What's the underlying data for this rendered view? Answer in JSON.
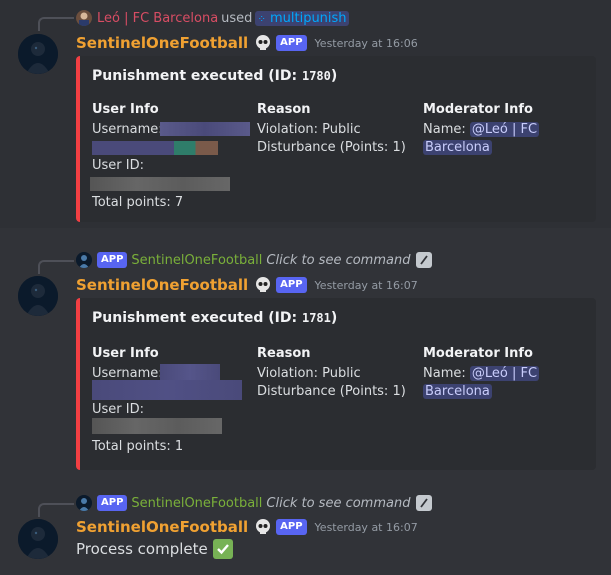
{
  "colors": {
    "accent": "#5865f2",
    "embed_bar": "#f23f43",
    "bot_name": "#f0a132"
  },
  "message1": {
    "reply_user": "Leó | FC Barcelona",
    "reply_used": "used",
    "reply_command": "multipunish",
    "author": "SentinelOneFootball",
    "badge": "APP",
    "timestamp": "Yesterday at 16:06",
    "embed": {
      "title_prefix": "Punishment executed (ID: ",
      "id": "1780",
      "title_suffix": ")",
      "user_info_label": "User Info",
      "username_label": "Username:",
      "userid_label": "User ID:",
      "total_points": "Total points: 7",
      "reason_label": "Reason",
      "reason_line1": "Violation: Public",
      "reason_line2": "Disturbance (Points: 1)",
      "moderator_label": "Moderator Info",
      "name_label": "Name:",
      "mod_line1": "@Leó | FC",
      "mod_line2": "Barcelona"
    }
  },
  "message2": {
    "reply_badge": "APP",
    "reply_user": "SentinelOneFootball",
    "reply_hint": "Click to see command",
    "author": "SentinelOneFootball",
    "badge": "APP",
    "timestamp": "Yesterday at 16:07",
    "embed": {
      "title_prefix": "Punishment executed (ID: ",
      "id": "1781",
      "title_suffix": ")",
      "user_info_label": "User Info",
      "username_label": "Username:",
      "userid_label": "User ID:",
      "total_points": "Total points: 1",
      "reason_label": "Reason",
      "reason_line1": "Violation: Public",
      "reason_line2": "Disturbance (Points: 1)",
      "moderator_label": "Moderator Info",
      "name_label": "Name:",
      "mod_line1": "@Leó | FC",
      "mod_line2": "Barcelona"
    }
  },
  "message3": {
    "reply_badge": "APP",
    "reply_user": "SentinelOneFootball",
    "reply_hint": "Click to see command",
    "author": "SentinelOneFootball",
    "badge": "APP",
    "timestamp": "Yesterday at 16:07",
    "content": "Process complete"
  }
}
